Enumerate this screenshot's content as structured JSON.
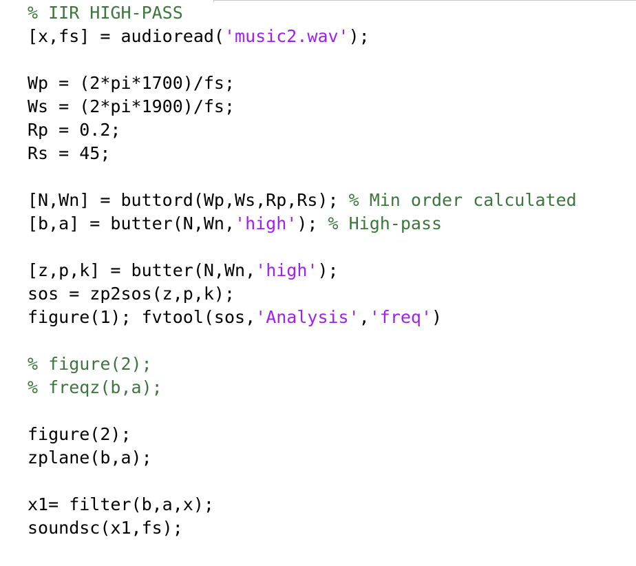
{
  "editor": {
    "colors": {
      "code": "#000000",
      "string": "#a020f0",
      "comment": "#3c763d"
    },
    "lines": [
      [
        {
          "t": "cmt",
          "v": "% IIR HIGH-PASS"
        }
      ],
      [
        {
          "t": "code",
          "v": "[x,fs] = audioread("
        },
        {
          "t": "str",
          "v": "'music2.wav'"
        },
        {
          "t": "code",
          "v": ");"
        }
      ],
      [],
      [
        {
          "t": "code",
          "v": "Wp = (2*pi*1700)/fs;"
        }
      ],
      [
        {
          "t": "code",
          "v": "Ws = (2*pi*1900)/fs;"
        }
      ],
      [
        {
          "t": "code",
          "v": "Rp = 0.2;"
        }
      ],
      [
        {
          "t": "code",
          "v": "Rs = 45;"
        }
      ],
      [],
      [
        {
          "t": "code",
          "v": "[N,Wn] = buttord(Wp,Ws,Rp,Rs); "
        },
        {
          "t": "cmt",
          "v": "% Min order calculated"
        }
      ],
      [
        {
          "t": "code",
          "v": "[b,a] = butter(N,Wn,"
        },
        {
          "t": "str",
          "v": "'high'"
        },
        {
          "t": "code",
          "v": "); "
        },
        {
          "t": "cmt",
          "v": "% High-pass"
        }
      ],
      [],
      [
        {
          "t": "code",
          "v": "[z,p,k] = butter(N,Wn,"
        },
        {
          "t": "str",
          "v": "'high'"
        },
        {
          "t": "code",
          "v": ");"
        }
      ],
      [
        {
          "t": "code",
          "v": "sos = zp2sos(z,p,k);"
        }
      ],
      [
        {
          "t": "code",
          "v": "figure(1); fvtool(sos,"
        },
        {
          "t": "str",
          "v": "'Analysis'"
        },
        {
          "t": "code",
          "v": ","
        },
        {
          "t": "str",
          "v": "'freq'"
        },
        {
          "t": "code",
          "v": ")"
        }
      ],
      [],
      [
        {
          "t": "cmt",
          "v": "% figure(2);"
        }
      ],
      [
        {
          "t": "cmt",
          "v": "% freqz(b,a);"
        }
      ],
      [],
      [
        {
          "t": "code",
          "v": "figure(2);"
        }
      ],
      [
        {
          "t": "code",
          "v": "zplane(b,a);"
        }
      ],
      [],
      [
        {
          "t": "code",
          "v": "x1= filter(b,a,x);"
        }
      ],
      [
        {
          "t": "code",
          "v": "soundsc(x1,fs);"
        }
      ]
    ]
  }
}
